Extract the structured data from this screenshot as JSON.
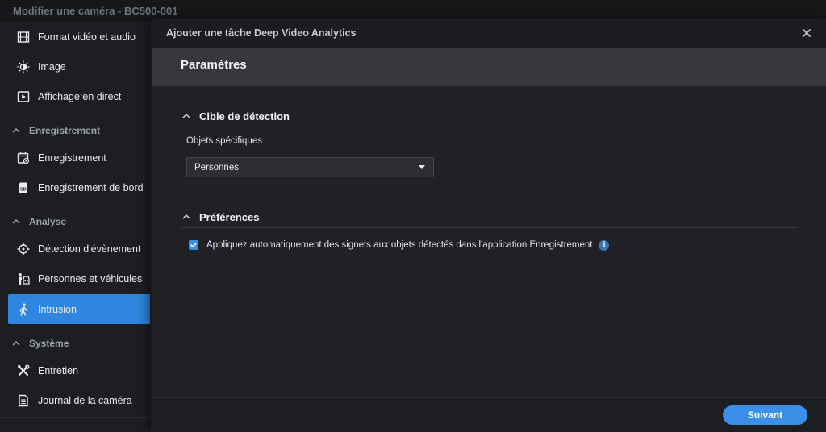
{
  "window": {
    "title": "Modifier une caméra - BC500-001"
  },
  "sidebar": {
    "items": [
      {
        "label": "Format vidéo et audio",
        "icon": "film-icon"
      },
      {
        "label": "Image",
        "icon": "brightness-icon"
      },
      {
        "label": "Affichage en direct",
        "icon": "play-box-icon"
      },
      {
        "label": "Enregistrement",
        "icon": "calendar-record-icon"
      },
      {
        "label": "Enregistrement de bord",
        "icon": "sd-card-icon"
      },
      {
        "label": "Détection d'évènement",
        "icon": "crosshair-icon"
      },
      {
        "label": "Personnes et véhicules",
        "icon": "person-vehicle-icon"
      },
      {
        "label": "Intrusion",
        "icon": "walking-person-icon",
        "active": true
      },
      {
        "label": "Entretien",
        "icon": "tools-icon"
      },
      {
        "label": "Journal de la caméra",
        "icon": "document-icon"
      }
    ],
    "sections": [
      {
        "label": "Enregistrement"
      },
      {
        "label": "Analyse"
      },
      {
        "label": "Système"
      }
    ]
  },
  "dialog": {
    "title": "Ajouter une tâche Deep Video Analytics",
    "header": "Paramètres",
    "detection": {
      "title": "Cible de détection",
      "field_label": "Objets spécifiques",
      "selected": "Personnes"
    },
    "preferences": {
      "title": "Préférences",
      "checkbox_label": "Appliquez automatiquement des signets aux objets détectés dans l'application Enregistrement",
      "checked": true
    },
    "next_label": "Suivant"
  },
  "colors": {
    "accent": "#3c8fe8",
    "active_item": "#2f86e0",
    "header_band": "#35373c"
  }
}
